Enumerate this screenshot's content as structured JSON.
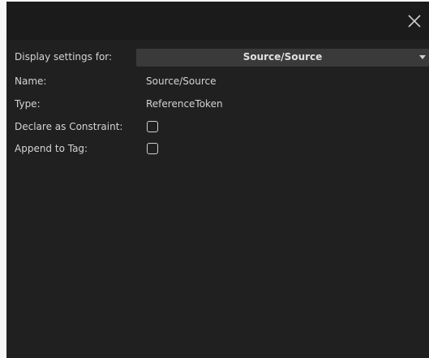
{
  "window": {
    "close_icon": "close-icon"
  },
  "display_settings": {
    "label": "Display settings for:",
    "selected": "Source/Source"
  },
  "fields": {
    "name_label": "Name:",
    "name_value": "Source/Source",
    "type_label": "Type:",
    "type_value": "ReferenceToken",
    "constraint_label": "Declare as Constraint:",
    "constraint_checked": false,
    "append_label": "Append to Tag:",
    "append_checked": false
  },
  "colors": {
    "background": "#202020",
    "titlebar": "#1b1b1b",
    "dropdown": "#3a3a3a",
    "text": "#d4d4d4"
  }
}
